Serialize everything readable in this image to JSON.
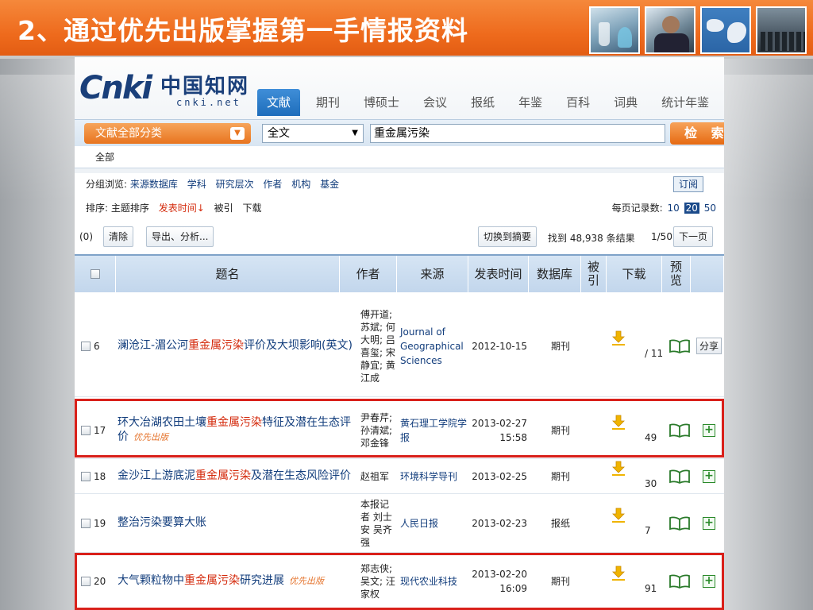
{
  "slide": {
    "title": "2、通过优先出版掌握第一手情报资料",
    "thumbnails": [
      "lab-beakers-image",
      "researcher-image",
      "world-map-image",
      "audience-image"
    ]
  },
  "cnki": {
    "logo": {
      "mark": "Cnki",
      "chinese": "中国知网",
      "domain": "cnki.net"
    },
    "tabs": [
      "文献",
      "期刊",
      "博硕士",
      "会议",
      "报纸",
      "年鉴",
      "百科",
      "词典",
      "统计年鉴"
    ],
    "active_tab": "文献",
    "search": {
      "category": "文献全部分类",
      "field": "全文",
      "query": "重金属污染",
      "button": "检 索"
    },
    "scope": "全部",
    "group_browse": {
      "label": "分组浏览:",
      "items": [
        "来源数据库",
        "学科",
        "研究层次",
        "作者",
        "机构",
        "基金"
      ],
      "subscribe": "订阅"
    },
    "sort": {
      "label": "排序:",
      "items": [
        "主题排序",
        "发表时间↓",
        "被引",
        "下载"
      ],
      "active": "发表时间↓",
      "per_page_label": "每页记录数:",
      "per_page_options": [
        "10",
        "20",
        "50"
      ],
      "per_page_selected": "20"
    },
    "toolbar": {
      "selected_count": "(0)",
      "clear": "清除",
      "export": "导出、分析...",
      "switch": "切换到摘要",
      "found": "找到 48,938 条结果",
      "page": "1/50",
      "next": "下一页"
    },
    "table_headers": {
      "title": "题名",
      "author": "作者",
      "source": "来源",
      "date": "发表时间",
      "db": "数据库",
      "cited": "被\n引",
      "download": "下载",
      "preview": "预\n览"
    },
    "rows": [
      {
        "num": "6",
        "title_pre": "澜沧江-湄公河",
        "title_hl": "重金属污染",
        "title_post": "评价及大坝影响(英文)",
        "tag": "",
        "author": "傅开道; 苏斌; 何大明; 吕喜玺; 宋静宜; 黄江成",
        "source": "Journal of Geographical Sciences",
        "date": "2012-10-15",
        "db": "期刊",
        "downloads": "/ 11",
        "action": "分享"
      },
      {
        "num": "17",
        "title_pre": "环大冶湖农田土壤",
        "title_hl": "重金属污染",
        "title_post": "特征及潜在生态评价",
        "tag": "优先出版",
        "author": "尹春芹; 孙清斌; 邓金锋",
        "source": "黄石理工学院学报",
        "date": "2013-02-27 15:58",
        "db": "期刊",
        "downloads": "49",
        "action": "+"
      },
      {
        "num": "18",
        "title_pre": "金沙江上游底泥",
        "title_hl": "重金属污染",
        "title_post": "及潜在生态风险评价",
        "tag": "",
        "author": "赵祖军",
        "source": "环境科学导刊",
        "date": "2013-02-25",
        "db": "期刊",
        "downloads": "30",
        "action": "+"
      },
      {
        "num": "19",
        "title_pre": "整治污染要算大账",
        "title_hl": "",
        "title_post": "",
        "tag": "",
        "author": "本报记者 刘士安 吴齐强",
        "source": "人民日报",
        "date": "2013-02-23",
        "db": "报纸",
        "downloads": "7",
        "action": "+"
      },
      {
        "num": "20",
        "title_pre": "大气颗粒物中",
        "title_hl": "重金属污染",
        "title_post": "研究进展",
        "tag": "优先出版",
        "author": "郑志侠; 吴文; 汪家权",
        "source": "现代农业科技",
        "date": "2013-02-20 16:09",
        "db": "期刊",
        "downloads": "91",
        "action": "+"
      }
    ]
  },
  "colors": {
    "title_bar": "#ee6a1c",
    "highlight": "#d42a0c",
    "link": "#123d7c",
    "frame": "#d9201a"
  }
}
